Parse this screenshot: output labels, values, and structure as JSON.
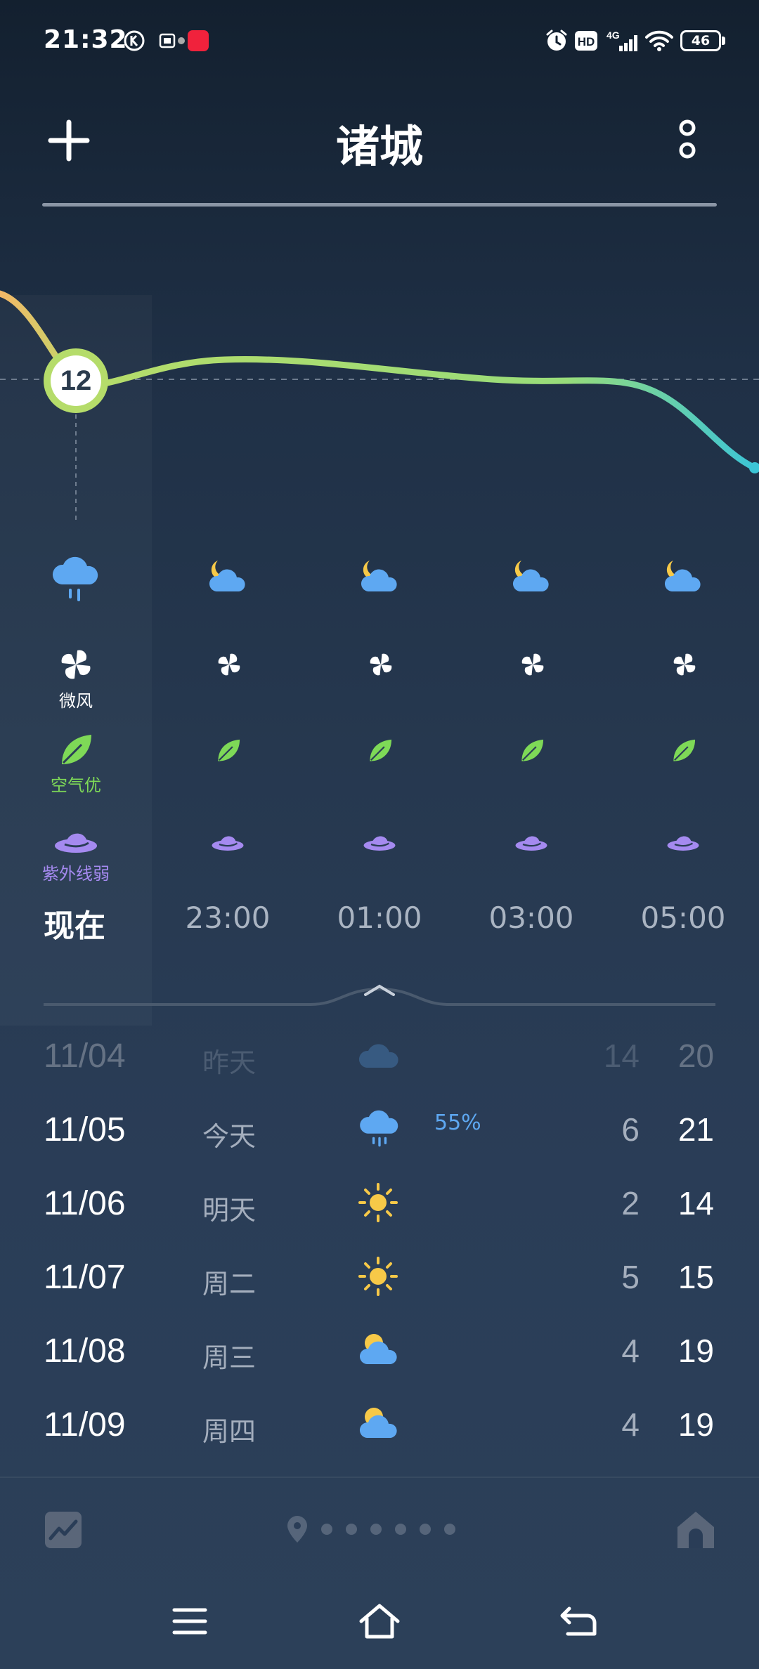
{
  "status_bar": {
    "time": "21:32",
    "battery": "46"
  },
  "header": {
    "city": "诸城",
    "add_icon": "plus-icon",
    "more_icon": "more-vertical-icon"
  },
  "hourly": {
    "current_temp": "12",
    "now_labels": {
      "wind": "微风",
      "air": "空气优",
      "uv": "紫外线弱"
    },
    "times": [
      "现在",
      "23:00",
      "01:00",
      "03:00",
      "05:00"
    ],
    "icons": [
      "rain-cloud-icon",
      "moon-cloud-icon",
      "moon-cloud-icon",
      "moon-cloud-icon",
      "moon-cloud-icon"
    ]
  },
  "daily": [
    {
      "date": "11/04",
      "day": "昨天",
      "icon": "cloud-icon",
      "precip": "",
      "low": "14",
      "high": "20",
      "past": true
    },
    {
      "date": "11/05",
      "day": "今天",
      "icon": "rain-cloud-icon",
      "precip": "55%",
      "low": "6",
      "high": "21",
      "past": false
    },
    {
      "date": "11/06",
      "day": "明天",
      "icon": "sun-icon",
      "precip": "",
      "low": "2",
      "high": "14",
      "past": false
    },
    {
      "date": "11/07",
      "day": "周二",
      "icon": "sun-icon",
      "precip": "",
      "low": "5",
      "high": "15",
      "past": false
    },
    {
      "date": "11/08",
      "day": "周三",
      "icon": "partly-cloudy-icon",
      "precip": "",
      "low": "4",
      "high": "19",
      "past": false
    },
    {
      "date": "11/09",
      "day": "周四",
      "icon": "partly-cloudy-icon",
      "precip": "",
      "low": "4",
      "high": "19",
      "past": false
    }
  ],
  "colors": {
    "accent_blue": "#5ea8f2",
    "air_green": "#7ed957",
    "uv_purple": "#a58af0",
    "curve_warm": "#f5b867",
    "curve_green": "#a8dc6e",
    "curve_cyan": "#3cc5d6"
  }
}
